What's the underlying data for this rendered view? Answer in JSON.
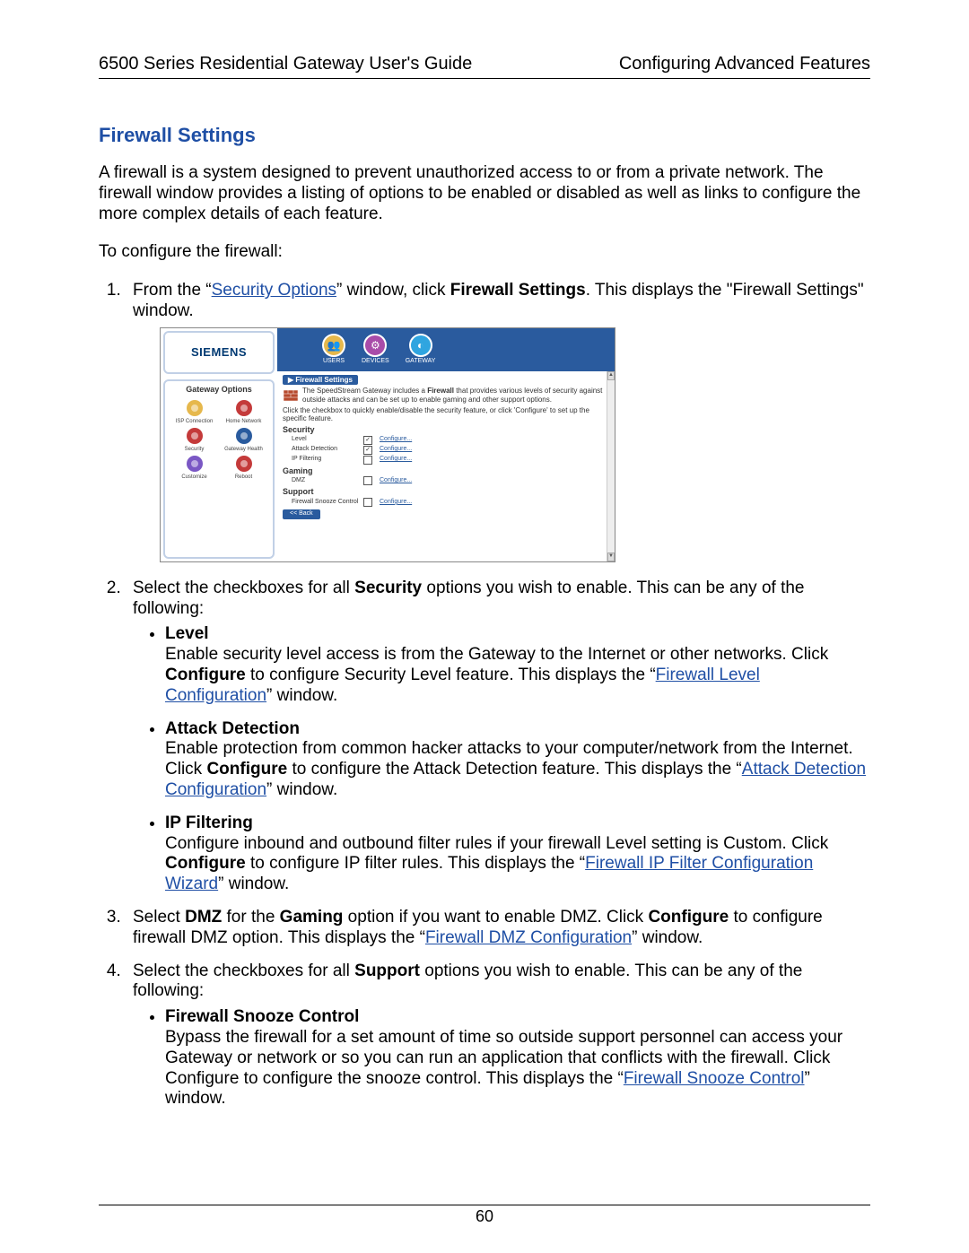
{
  "header": {
    "left": "6500 Series Residential Gateway User's Guide",
    "right": "Configuring Advanced Features"
  },
  "title": "Firewall Settings",
  "intro": "A firewall is a system designed to prevent unauthorized access to or from a private network. The firewall window provides a listing of options to be enabled or disabled as well as links to configure the more complex details of each feature.",
  "lead_in": "To configure the firewall:",
  "step1_pre": "From the “",
  "step1_link": "Security Options",
  "step1_mid": "” window, click ",
  "step1_bold": "Firewall Settings",
  "step1_post": ". This displays the \"Firewall Settings\" window.",
  "step2_pre": "Select the checkboxes for all ",
  "step2_bold": "Security",
  "step2_post": " options you wish to enable. This can be any of the following:",
  "b_level_title": "Level",
  "b_level_1": "Enable security level access is from the Gateway to the Internet or other networks. Click ",
  "b_level_bold": "Configure",
  "b_level_2": " to configure Security Level feature. This displays the “",
  "b_level_link": "Firewall Level Configuration",
  "b_level_3": "” window.",
  "b_attack_title": "Attack Detection",
  "b_attack_1": "Enable protection from common hacker attacks to your computer/network from the Internet. Click ",
  "b_attack_bold": "Configure",
  "b_attack_2": " to configure the Attack Detection feature. This displays the “",
  "b_attack_link": "Attack Detection Configuration",
  "b_attack_3": "” window.",
  "b_ip_title": "IP Filtering",
  "b_ip_1": "Configure inbound and outbound filter rules if your firewall Level setting is Custom. Click ",
  "b_ip_bold": "Configure",
  "b_ip_2": " to configure IP filter rules. This displays the “",
  "b_ip_link": "Firewall IP Filter Configuration Wizard",
  "b_ip_3": "” window.",
  "step3_1": "Select ",
  "step3_b1": "DMZ",
  "step3_2": " for the ",
  "step3_b2": "Gaming",
  "step3_3": " option if you want to enable DMZ. Click ",
  "step3_b3": "Configure",
  "step3_4": " to configure firewall DMZ option. This displays the “",
  "step3_link": "Firewall DMZ Configuration",
  "step3_5": "” window.",
  "step4_pre": "Select the checkboxes for all ",
  "step4_bold": "Support",
  "step4_post": " options you wish to enable. This can be any of the following:",
  "b_snooze_title": "Firewall Snooze Control",
  "b_snooze_1": "Bypass the firewall for a set amount of time so outside support personnel can access your Gateway or network or so you can run an application that conflicts with the firewall. Click Configure to configure the snooze control. This displays the “",
  "b_snooze_link": "Firewall Snooze Control",
  "b_snooze_2": "” window.",
  "pagenum": "60",
  "shot": {
    "logo": "SIEMENS",
    "opts_title": "Gateway Options",
    "icons": [
      {
        "label": "ISP Connection",
        "color": "#e6b84c"
      },
      {
        "label": "Home Network",
        "color": "#c43a3a"
      },
      {
        "label": "Security",
        "color": "#c43a3a"
      },
      {
        "label": "Gateway Health",
        "color": "#2a5b9e"
      },
      {
        "label": "Customize",
        "color": "#7a57c4"
      },
      {
        "label": "Reboot",
        "color": "#c43a3a"
      }
    ],
    "top": [
      {
        "label": "USERS",
        "glyph": "👥",
        "bg": "#e6b84c"
      },
      {
        "label": "DEVICES",
        "glyph": "⚙",
        "bg": "#a94ca9"
      },
      {
        "label": "GATEWAY",
        "glyph": "◐",
        "bg": "#2fa5e0"
      }
    ],
    "breadcrumb": "▶ Firewall Settings",
    "intro1": "The SpeedStream Gateway includes a ",
    "intro1b": "Firewall",
    "intro2": " that provides various levels of security against outside attacks and can be set up to enable gaming and other support options.",
    "intro3": "Click the checkbox to quickly enable/disable the security feature, or click 'Configure' to set up the specific feature.",
    "sections": [
      {
        "title": "Security",
        "rows": [
          {
            "label": "Level",
            "checked": true,
            "action": "Configure..."
          },
          {
            "label": "Attack Detection",
            "checked": true,
            "action": "Configure..."
          },
          {
            "label": "IP Filtering",
            "checked": false,
            "action": "Configure..."
          }
        ]
      },
      {
        "title": "Gaming",
        "rows": [
          {
            "label": "DMZ",
            "checked": false,
            "action": "Configure..."
          }
        ]
      },
      {
        "title": "Support",
        "rows": [
          {
            "label": "Firewall Snooze Control",
            "checked": false,
            "action": "Configure..."
          }
        ]
      }
    ],
    "back": "<< Back"
  }
}
